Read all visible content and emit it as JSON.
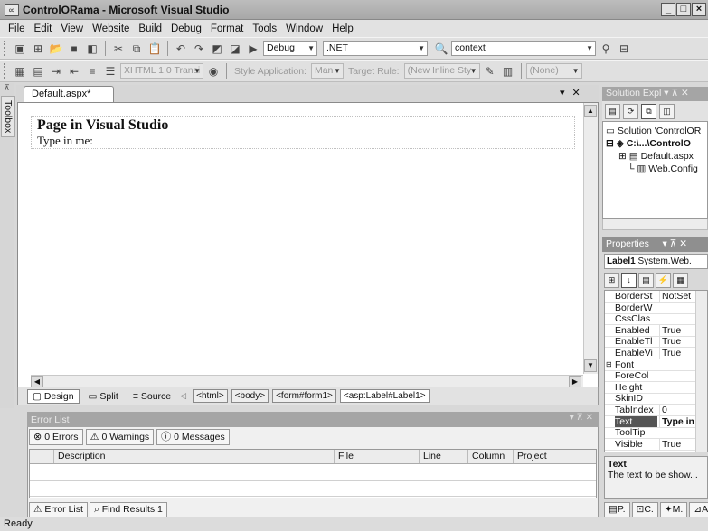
{
  "window": {
    "title": "ControlORama - Microsoft Visual Studio",
    "minimize": "_",
    "maximize": "□",
    "close": "×"
  },
  "menu": [
    "File",
    "Edit",
    "View",
    "Website",
    "Build",
    "Debug",
    "Format",
    "Tools",
    "Window",
    "Help"
  ],
  "toolbar1": {
    "config": "Debug",
    "platform": ".NET",
    "find": "context"
  },
  "toolbar2": {
    "doctype": "XHTML 1.0 Transi",
    "style_application_label": "Style Application:",
    "style_application_value": "Man",
    "target_rule_label": "Target Rule:",
    "target_rule_value": "(New Inline Sty",
    "style_value": "(None)"
  },
  "toolbox": {
    "label": "Toolbox"
  },
  "document": {
    "tab": "Default.aspx*",
    "heading": "Page in Visual Studio",
    "label": "Type in me:"
  },
  "views": [
    "Design",
    "Split",
    "Source"
  ],
  "breadcrumbs": [
    "<html>",
    "<body>",
    "<form#form1>",
    "<asp:Label#Label1>"
  ],
  "error_list": {
    "title": "Error List",
    "errors": "0 Errors",
    "warnings": "0 Warnings",
    "messages": "0 Messages",
    "columns": [
      "Description",
      "File",
      "Line",
      "Column",
      "Project"
    ]
  },
  "bottom_tabs": [
    "Error List",
    "Find Results 1"
  ],
  "status": "Ready",
  "solution_explorer": {
    "title": "Solution Expl",
    "nodes": [
      "Solution 'ControlOR",
      "C:\\...\\ControlO",
      "Default.aspx",
      "Web.Config"
    ]
  },
  "properties": {
    "title": "Properties",
    "object_name": "Label1",
    "object_type": "System.Web.",
    "rows": [
      {
        "name": "BorderSt",
        "value": "NotSet"
      },
      {
        "name": "BorderW",
        "value": ""
      },
      {
        "name": "CssClas",
        "value": ""
      },
      {
        "name": "Enabled",
        "value": "True"
      },
      {
        "name": "EnableTl",
        "value": "True"
      },
      {
        "name": "EnableVi",
        "value": "True"
      },
      {
        "name": "Font",
        "value": ""
      },
      {
        "name": "ForeCol",
        "value": ""
      },
      {
        "name": "Height",
        "value": ""
      },
      {
        "name": "SkinID",
        "value": ""
      },
      {
        "name": "TabIndex",
        "value": "0"
      },
      {
        "name": "Text",
        "value": "Type in"
      },
      {
        "name": "ToolTip",
        "value": ""
      },
      {
        "name": "Visible",
        "value": "True"
      }
    ],
    "desc_title": "Text",
    "desc_text": "The text to be show...",
    "tabs": [
      "P.",
      "C.",
      "M.",
      "A."
    ]
  }
}
